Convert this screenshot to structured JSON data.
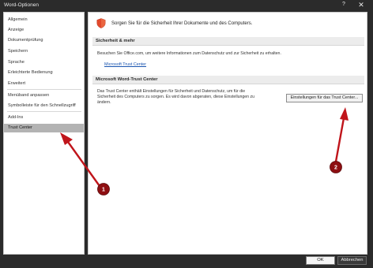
{
  "window": {
    "title": "Word-Optionen",
    "help_icon": "?",
    "close_icon": "✕"
  },
  "sidebar": {
    "items": [
      {
        "label": "Allgemein"
      },
      {
        "label": "Anzeige"
      },
      {
        "label": "Dokumentprüfung"
      },
      {
        "label": "Speichern"
      },
      {
        "label": "Sprache"
      },
      {
        "label": "Erleichterte Bedienung"
      },
      {
        "label": "Erweitert"
      },
      {
        "label": "Menüband anpassen"
      },
      {
        "label": "Symbolleiste für den Schnellzugriff"
      },
      {
        "label": "Add-Ins"
      },
      {
        "label": "Trust Center",
        "selected": true
      }
    ]
  },
  "main": {
    "intro": "Sorgen Sie für die Sicherheit Ihrer Dokumente und des Computers.",
    "section_security": {
      "heading": "Sicherheit & mehr",
      "text": "Besuchen Sie Office.com, um weitere Informationen zum Datenschutz und zur Sicherheit zu erhalten.",
      "link": "Microsoft Trust Center"
    },
    "section_trust": {
      "heading": "Microsoft Word-Trust Center",
      "text_line1": "Das Trust Center enthält Einstellungen für Sicherheit und Datenschutz, um für die",
      "text_line2": "Sicherheit des Computers zu sorgen. Es wird davon abgeraten, diese Einstellungen zu",
      "text_line3": "ändern.",
      "button": "Einstellungen für das Trust Center..."
    }
  },
  "footer": {
    "ok": "OK",
    "cancel": "Abbrechen"
  },
  "annotations": {
    "badge1": "1",
    "badge2": "2",
    "color": "#c0151b"
  },
  "colors": {
    "shield": "#e2492c",
    "link": "#1a55b0",
    "selected_nav": "#b3b3b3"
  }
}
